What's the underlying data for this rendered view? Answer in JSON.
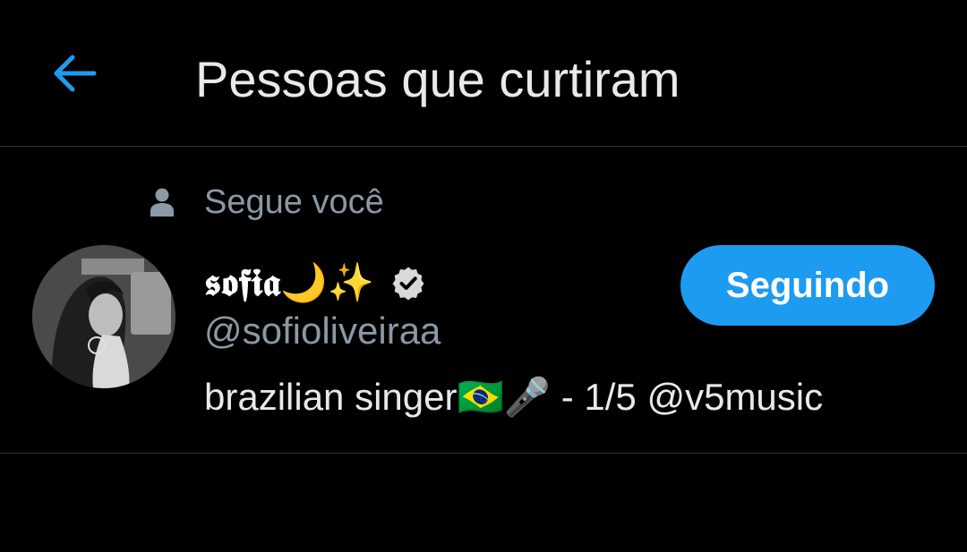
{
  "header": {
    "back_icon": "arrow-left-icon",
    "title": "Pessoas que curtiram"
  },
  "users": [
    {
      "social_context_icon": "person-icon",
      "social_context": "Segue você",
      "display_name": "𝖘𝖔𝖋𝖎𝖆🌙✨",
      "verified": true,
      "handle": "@sofioliveiraa",
      "bio": "brazilian singer🇧🇷🎤 - 1/5 @v5music",
      "follow_button_label": "Seguindo"
    }
  ],
  "colors": {
    "background": "#000000",
    "accent": "#1d9bf0",
    "secondary_text": "#8b98a5",
    "divider": "#2f3336"
  }
}
